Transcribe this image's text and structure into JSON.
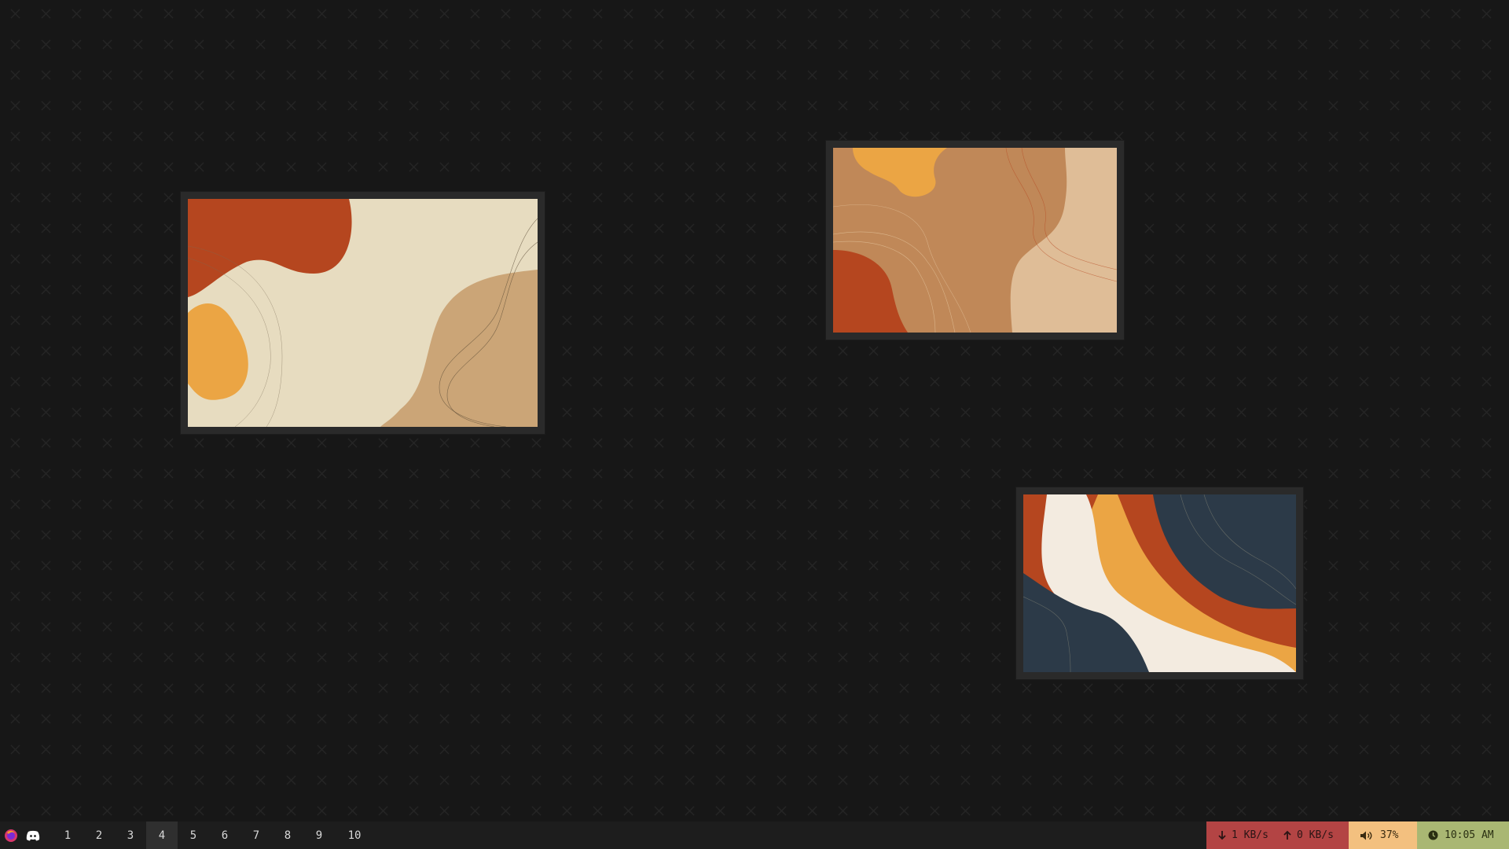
{
  "desktop": {
    "wallpaper_pattern": "x-cross-tile",
    "background_color": "#171717",
    "windows": [
      {
        "name": "image-viewer-window-1",
        "palette": [
          "#b5461f",
          "#e7dcc0",
          "#eba544",
          "#cba577"
        ]
      },
      {
        "name": "image-viewer-window-2",
        "palette": [
          "#c08858",
          "#eba544",
          "#b5461f",
          "#dfbd97"
        ]
      },
      {
        "name": "image-viewer-window-3",
        "palette": [
          "#2c3a48",
          "#b5461f",
          "#eba544",
          "#f3ebe0"
        ]
      }
    ]
  },
  "taskbar": {
    "apps": [
      {
        "name": "firefox-icon",
        "color": "#d6366b"
      },
      {
        "name": "discord-icon",
        "color": "#ffffff"
      }
    ],
    "workspaces": [
      "1",
      "2",
      "3",
      "4",
      "5",
      "6",
      "7",
      "8",
      "9",
      "10"
    ],
    "active_workspace": "4",
    "network": {
      "down_icon": "arrow-down-icon",
      "down": "1 KB/s",
      "up_icon": "arrow-up-icon",
      "up": "0 KB/s",
      "color": "#b34444"
    },
    "volume": {
      "icon": "speaker-icon",
      "level": "37%",
      "color": "#f3c07f"
    },
    "clock": {
      "icon": "clock-icon",
      "time": "10:05 AM",
      "color": "#a9b773"
    }
  }
}
